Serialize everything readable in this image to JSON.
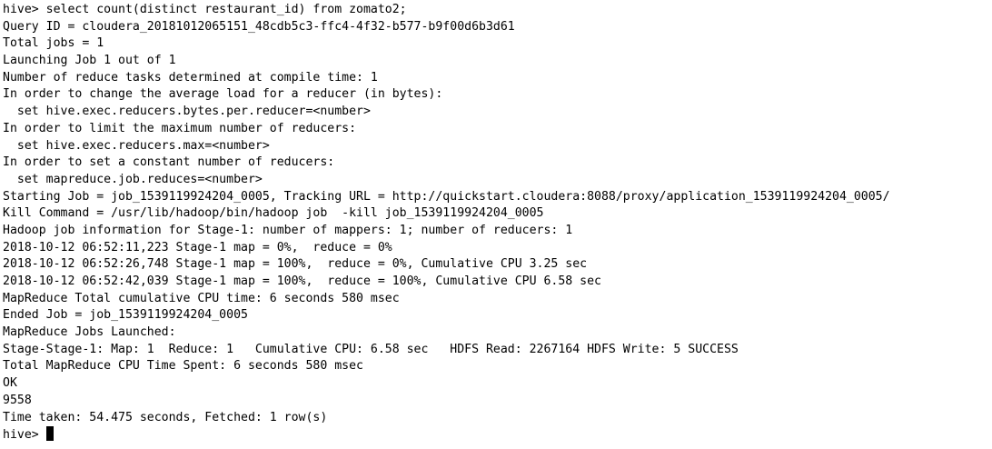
{
  "terminal": {
    "lines": [
      "hive> select count(distinct restaurant_id) from zomato2;",
      "Query ID = cloudera_20181012065151_48cdb5c3-ffc4-4f32-b577-b9f00d6b3d61",
      "Total jobs = 1",
      "Launching Job 1 out of 1",
      "Number of reduce tasks determined at compile time: 1",
      "In order to change the average load for a reducer (in bytes):",
      "  set hive.exec.reducers.bytes.per.reducer=<number>",
      "In order to limit the maximum number of reducers:",
      "  set hive.exec.reducers.max=<number>",
      "In order to set a constant number of reducers:",
      "  set mapreduce.job.reduces=<number>",
      "Starting Job = job_1539119924204_0005, Tracking URL = http://quickstart.cloudera:8088/proxy/application_1539119924204_0005/",
      "Kill Command = /usr/lib/hadoop/bin/hadoop job  -kill job_1539119924204_0005",
      "Hadoop job information for Stage-1: number of mappers: 1; number of reducers: 1",
      "2018-10-12 06:52:11,223 Stage-1 map = 0%,  reduce = 0%",
      "2018-10-12 06:52:26,748 Stage-1 map = 100%,  reduce = 0%, Cumulative CPU 3.25 sec",
      "2018-10-12 06:52:42,039 Stage-1 map = 100%,  reduce = 100%, Cumulative CPU 6.58 sec",
      "MapReduce Total cumulative CPU time: 6 seconds 580 msec",
      "Ended Job = job_1539119924204_0005",
      "MapReduce Jobs Launched:",
      "Stage-Stage-1: Map: 1  Reduce: 1   Cumulative CPU: 6.58 sec   HDFS Read: 2267164 HDFS Write: 5 SUCCESS",
      "Total MapReduce CPU Time Spent: 6 seconds 580 msec",
      "OK",
      "9558",
      "Time taken: 54.475 seconds, Fetched: 1 row(s)"
    ],
    "prompt": "hive> "
  }
}
